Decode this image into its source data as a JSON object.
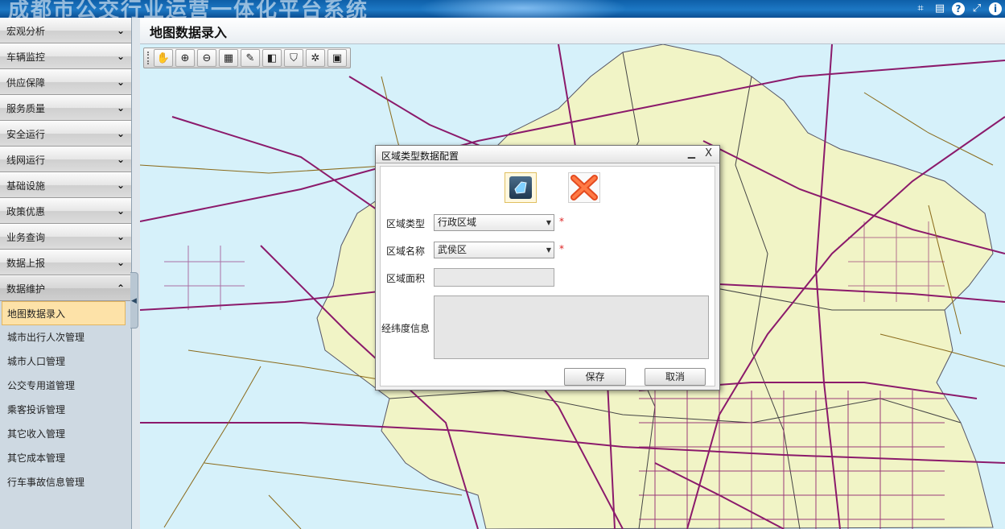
{
  "banner": {
    "title": "成都市公交行业运营一体化平台系统",
    "tools": [
      {
        "icon": "crop-icon",
        "glyph": "⌗"
      },
      {
        "icon": "keyboard-icon",
        "glyph": "▤"
      },
      {
        "icon": "help-icon",
        "glyph": "?"
      },
      {
        "icon": "expand-icon",
        "glyph": "⤢"
      },
      {
        "icon": "info-icon",
        "glyph": "i"
      }
    ]
  },
  "sidebar": {
    "sections": [
      {
        "label": "宏观分析"
      },
      {
        "label": "车辆监控"
      },
      {
        "label": "供应保障"
      },
      {
        "label": "服务质量"
      },
      {
        "label": "安全运行"
      },
      {
        "label": "线网运行"
      },
      {
        "label": "基础设施"
      },
      {
        "label": "政策优惠"
      },
      {
        "label": "业务查询"
      },
      {
        "label": "数据上报"
      },
      {
        "label": "数据维护"
      }
    ],
    "chevron_closed": "⌄",
    "chevron_open": "⌃",
    "sub_items": [
      {
        "label": "地图数据录入"
      },
      {
        "label": "城市出行人次管理"
      },
      {
        "label": "城市人口管理"
      },
      {
        "label": "公交专用道管理"
      },
      {
        "label": "乘客投诉管理"
      },
      {
        "label": "其它收入管理"
      },
      {
        "label": "其它成本管理"
      },
      {
        "label": "行车事故信息管理"
      }
    ],
    "collapse_glyph": "◀"
  },
  "page": {
    "title": "地图数据录入"
  },
  "map_toolbar": {
    "buttons": [
      {
        "icon": "pan-hand-icon",
        "glyph": "✋"
      },
      {
        "icon": "zoom-in-icon",
        "glyph": "⊕"
      },
      {
        "icon": "zoom-out-icon",
        "glyph": "⊖"
      },
      {
        "icon": "full-extent-icon",
        "glyph": "▦"
      },
      {
        "icon": "edit-icon",
        "glyph": "✎"
      },
      {
        "icon": "layers-icon",
        "glyph": "◧"
      },
      {
        "icon": "shield-icon",
        "glyph": "⛉"
      },
      {
        "icon": "clear-icon",
        "glyph": "✲"
      },
      {
        "icon": "database-icon",
        "glyph": "▣"
      }
    ]
  },
  "dialog": {
    "title": "区域类型数据配置",
    "minimize_glyph": "▁",
    "close_glyph": "X",
    "region_type_label": "区域类型",
    "region_type_value": "行政区域",
    "region_name_label": "区域名称",
    "region_name_value": "武侯区",
    "area_label": "区域面积",
    "area_value": "",
    "coords_label": "经纬度信息",
    "coords_value": "",
    "required_mark": "*",
    "save_label": "保存",
    "cancel_label": "取消"
  },
  "colors": {
    "map_water": "#d6f1fa",
    "map_land": "#f1f4c6",
    "road_major": "#8b1a6b",
    "road_minor": "#8a6a1a",
    "active_item": "#fde2a8"
  }
}
